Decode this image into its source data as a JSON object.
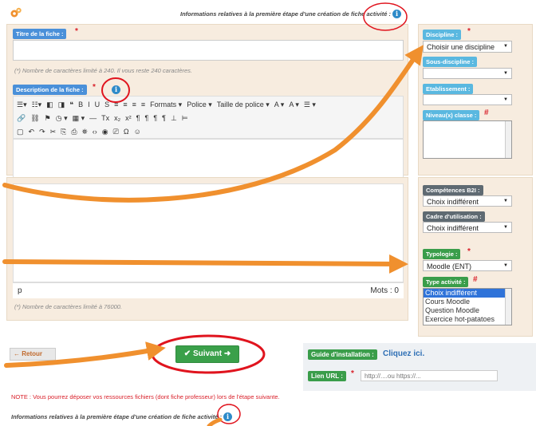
{
  "header": {
    "title": "Informations relatives à la première étape d'une création de fiche activité :",
    "info_glyph": "i"
  },
  "titre": {
    "label": "Titre de la fiche :",
    "required": "*",
    "note": "(*) Nombre de caractères limité à 240. Il vous reste 240 caractères."
  },
  "description": {
    "label": "Description de la fiche :",
    "required": "*",
    "toolbar_row1": [
      "☰▾",
      "☷▾",
      "◧",
      "◨",
      "❝",
      "B",
      "I",
      "U",
      "S",
      "≡",
      "≡",
      "≡",
      "≡",
      "Formats ▾",
      "Police ▾",
      "Taille de police ▾",
      "A ▾",
      "A ▾",
      "☰ ▾"
    ],
    "toolbar_row2": [
      "🔗",
      "⛓",
      "⚑",
      "◷ ▾",
      "▦ ▾",
      "—",
      "Tx",
      "x₂",
      "x²",
      "¶",
      "¶",
      "¶",
      "¶",
      "⊥",
      "⊨"
    ],
    "toolbar_row3": [
      "▢",
      "↶",
      "↷",
      "✂",
      "⎘",
      "⎙",
      "⛯",
      "‹›",
      "◉",
      "⎚",
      "Ω",
      "☺"
    ],
    "status_path": "p",
    "word_count": "Mots : 0",
    "note": "(*) Nombre de caractères limité à 76000."
  },
  "discipline": {
    "label": "Discipline :",
    "required": "*",
    "value": "Choisir une discipline"
  },
  "sous_discipline": {
    "label": "Sous-discipline :",
    "value": ""
  },
  "etablissement": {
    "label": "Etablissement :",
    "value": ""
  },
  "niveau": {
    "label": "Niveau(x) classe :",
    "required": "#"
  },
  "competences": {
    "label": "Compétences B2I :",
    "value": "Choix indifférent"
  },
  "cadre": {
    "label": "Cadre d'utilisation :",
    "value": "Choix indifférent"
  },
  "typologie": {
    "label": "Typologie :",
    "required": "*",
    "value": "Moodle (ENT)"
  },
  "type_activite": {
    "label": "Type activité :",
    "required": "#",
    "options": [
      "Choix indifférent",
      "Cours Moodle",
      "Question Moodle",
      "Exercice hot-patatoes"
    ]
  },
  "buttons": {
    "retour": "← Retour",
    "suivant": "✔ Suivant ➜"
  },
  "guide": {
    "label": "Guide d'installation :",
    "link": "Cliquez ici.",
    "url_label": "Lien URL :",
    "url_required": "*",
    "url_placeholder": "http://....ou https://..."
  },
  "footer": {
    "note": "NOTE : Vous pourrez déposer vos ressources fichiers (dont fiche professeur) lors de l'étape suivante.",
    "title": "Informations relatives à la première étape d'une création de fiche activité :"
  },
  "colors": {
    "accent_orange": "#f0902e",
    "annotation_red": "#e0141e",
    "panel_bg": "#f7ecdf",
    "btn_green": "#3aa04a"
  }
}
